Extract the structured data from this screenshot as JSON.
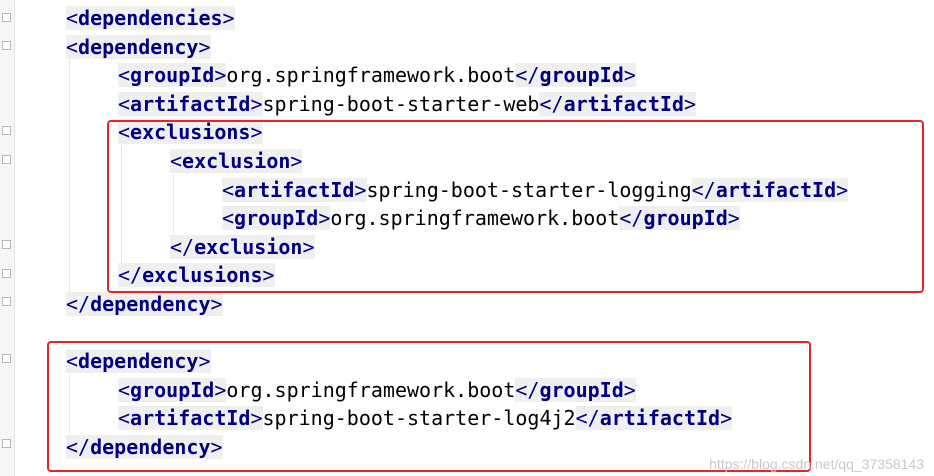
{
  "lines": [
    {
      "indent": 0,
      "open": "<",
      "tag": "dependencies",
      "close": ">",
      "text": ""
    },
    {
      "indent": 0,
      "open": "<",
      "tag": "dependency",
      "close": ">",
      "text": ""
    },
    {
      "indent": 1,
      "open": "<",
      "tag": "groupId",
      "close": ">",
      "text": "org.springframework.boot",
      "end_open": "</",
      "end_tag": "groupId",
      "end_close": ">"
    },
    {
      "indent": 1,
      "open": "<",
      "tag": "artifactId",
      "close": ">",
      "text": "spring-boot-starter-web",
      "end_open": "</",
      "end_tag": "artifactId",
      "end_close": ">"
    },
    {
      "indent": 1,
      "open": "<",
      "tag": "exclusions",
      "close": ">",
      "text": ""
    },
    {
      "indent": 2,
      "open": "<",
      "tag": "exclusion",
      "close": ">",
      "text": ""
    },
    {
      "indent": 3,
      "open": "<",
      "tag": "artifactId",
      "close": ">",
      "text": "spring-boot-starter-logging",
      "end_open": "</",
      "end_tag": "artifactId",
      "end_close": ">"
    },
    {
      "indent": 3,
      "open": "<",
      "tag": "groupId",
      "close": ">",
      "text": "org.springframework.boot",
      "end_open": "</",
      "end_tag": "groupId",
      "end_close": ">"
    },
    {
      "indent": 2,
      "open": "</",
      "tag": "exclusion",
      "close": ">",
      "text": ""
    },
    {
      "indent": 1,
      "open": "</",
      "tag": "exclusions",
      "close": ">",
      "text": ""
    },
    {
      "indent": 0,
      "open": "</",
      "tag": "dependency",
      "close": ">",
      "text": ""
    },
    {
      "indent": 0,
      "open": "",
      "tag": "",
      "close": "",
      "text": ""
    },
    {
      "indent": 0,
      "open": "<",
      "tag": "dependency",
      "close": ">",
      "text": ""
    },
    {
      "indent": 1,
      "open": "<",
      "tag": "groupId",
      "close": ">",
      "text": "org.springframework.boot",
      "end_open": "</",
      "end_tag": "groupId",
      "end_close": ">"
    },
    {
      "indent": 1,
      "open": "<",
      "tag": "artifactId",
      "close": ">",
      "text": "spring-boot-starter-log4j2",
      "end_open": "</",
      "end_tag": "artifactId",
      "end_close": ">"
    },
    {
      "indent": 0,
      "open": "</",
      "tag": "dependency",
      "close": ">",
      "text": ""
    }
  ],
  "colors": {
    "tag": "#000080",
    "tag_background": "#efefef",
    "highlight_border": "#e8242a",
    "watermark": "#c9c9c9"
  },
  "watermark": "https://blog.csdn.net/qq_37358143"
}
